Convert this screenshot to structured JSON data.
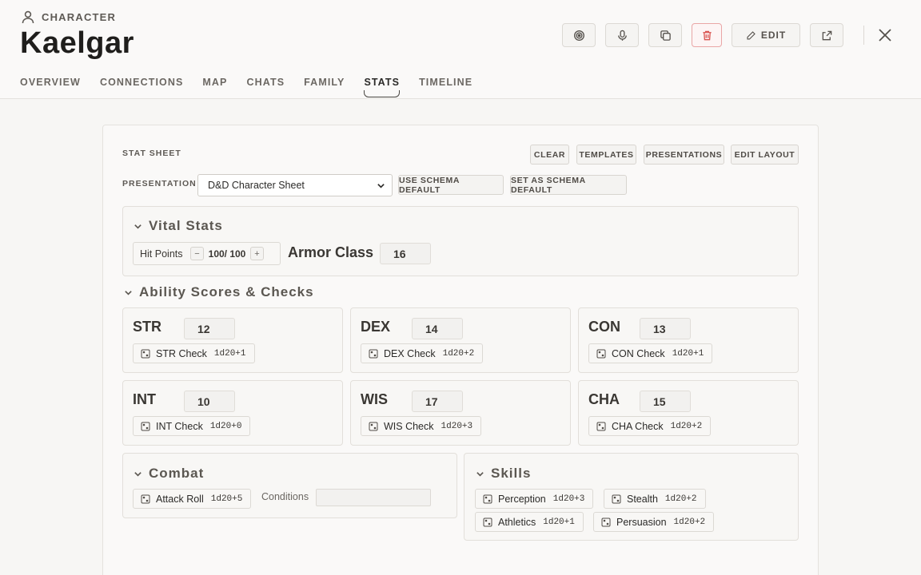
{
  "header": {
    "kind_label": "CHARACTER",
    "title": "Kaelgar",
    "actions": [
      {
        "name": "target-button",
        "icon": "target-icon"
      },
      {
        "name": "microphone-button",
        "icon": "microphone-icon"
      },
      {
        "name": "copy-button",
        "icon": "copy-icon"
      },
      {
        "name": "delete-button",
        "icon": "trash-icon",
        "color": "#d9534f"
      },
      {
        "name": "edit-button",
        "icon": "pencil-icon",
        "label": "EDIT"
      },
      {
        "name": "open-external-button",
        "icon": "external-link-icon"
      }
    ],
    "close_icon": "close-icon"
  },
  "tabs": [
    {
      "label": "OVERVIEW",
      "active": false
    },
    {
      "label": "CONNECTIONS",
      "active": false
    },
    {
      "label": "MAP",
      "active": false
    },
    {
      "label": "CHATS",
      "active": false
    },
    {
      "label": "FAMILY",
      "active": false
    },
    {
      "label": "STATS",
      "active": true
    },
    {
      "label": "TIMELINE",
      "active": false
    }
  ],
  "stat_sheet": {
    "label": "STAT SHEET",
    "toolbar": {
      "clear": "CLEAR",
      "templates": "TEMPLATES",
      "presentations": "PRESENTATIONS",
      "edit_layout": "EDIT LAYOUT"
    },
    "presentation_label": "PRESENTATION",
    "presentation_value": "D&D Character Sheet",
    "use_schema_default": "USE SCHEMA DEFAULT",
    "set_as_schema_default": "SET AS SCHEMA DEFAULT",
    "vital": {
      "title": "Vital Stats",
      "hp_label": "Hit Points",
      "hp_value": "100/ 100",
      "hp_minus": "−",
      "hp_plus": "+",
      "armor_label": "Armor Class",
      "armor_value": "16"
    },
    "abilities": {
      "title": "Ability Scores & Checks",
      "items": [
        {
          "code": "STR",
          "score": "12",
          "check": "STR Check",
          "dice": "1d20+1"
        },
        {
          "code": "DEX",
          "score": "14",
          "check": "DEX Check",
          "dice": "1d20+2"
        },
        {
          "code": "CON",
          "score": "13",
          "check": "CON Check",
          "dice": "1d20+1"
        },
        {
          "code": "INT",
          "score": "10",
          "check": "INT Check",
          "dice": "1d20+0"
        },
        {
          "code": "WIS",
          "score": "17",
          "check": "WIS Check",
          "dice": "1d20+3"
        },
        {
          "code": "CHA",
          "score": "15",
          "check": "CHA Check",
          "dice": "1d20+2"
        }
      ]
    },
    "combat": {
      "title": "Combat",
      "attack_label": "Attack Roll",
      "attack_dice": "1d20+5",
      "conditions_label": "Conditions",
      "conditions_value": ""
    },
    "skills": {
      "title": "Skills",
      "items": [
        {
          "label": "Perception",
          "dice": "1d20+3"
        },
        {
          "label": "Stealth",
          "dice": "1d20+2"
        },
        {
          "label": "Athletics",
          "dice": "1d20+1"
        },
        {
          "label": "Persuasion",
          "dice": "1d20+2"
        }
      ]
    }
  }
}
